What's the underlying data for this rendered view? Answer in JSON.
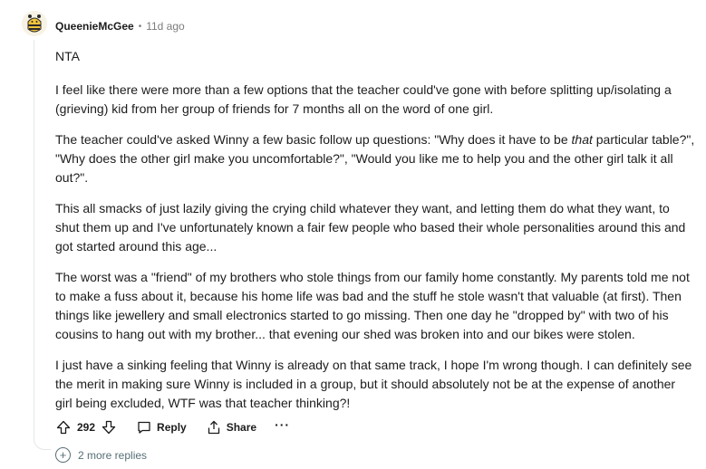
{
  "comment": {
    "username": "QueenieMcGee",
    "separator": "•",
    "timestamp": "11d ago",
    "avatar_icon": "bee-avatar-icon",
    "paragraphs": {
      "p1": "NTA",
      "p2": {
        "l1": "I feel like there were more than a few options that the teacher could've gone with before splitting up/isolating a",
        "l2": "(grieving) kid from her group of friends for 7 months all on the word of one girl."
      },
      "p3": {
        "l1_before": "The teacher could've asked Winny a few basic follow up questions: \"Why does it have to be ",
        "l1_italic": "that",
        "l1_after": " particular table?\",",
        "l2": "\"Why does the other girl make you uncomfortable?\", \"Would you like me to help you and the other girl talk it all",
        "l3": "out?\"."
      },
      "p4": {
        "l1": "This all smacks of just lazily giving the crying child whatever they want, and letting them do what they want, to",
        "l2": "shut them up and I've unfortunately known a fair few people who based their whole personalities around this and",
        "l3": "got started around this age..."
      },
      "p5": {
        "l1": "The worst was a \"friend\" of my brothers who stole things from our family home constantly. My parents told me not",
        "l2": "to make a fuss about it, because his home life was bad and the stuff he stole wasn't that valuable (at first). Then",
        "l3": "things like jewellery and small electronics started to go missing. Then one day he \"dropped by\" with two of his",
        "l4": "cousins to hang out with my brother... that evening our shed was broken into and our bikes were stolen."
      },
      "p6": {
        "l1": "I just have a sinking feeling that Winny is already on that same track, I hope I'm wrong though. I can definitely see",
        "l2": "the merit in making sure Winny is included in a group, but it should absolutely not be at the expense of another",
        "l3": "girl being excluded, WTF was that teacher thinking?!"
      }
    },
    "actions": {
      "vote_count": "292",
      "reply_label": "Reply",
      "share_label": "Share",
      "more_label": "···"
    },
    "more_replies": {
      "plus": "+",
      "label": "2 more replies"
    }
  },
  "colors": {
    "text": "#1c1c1c",
    "meta": "#7c7c7c",
    "thread_line": "#e3e6e8",
    "more_replies": "#576f76"
  }
}
